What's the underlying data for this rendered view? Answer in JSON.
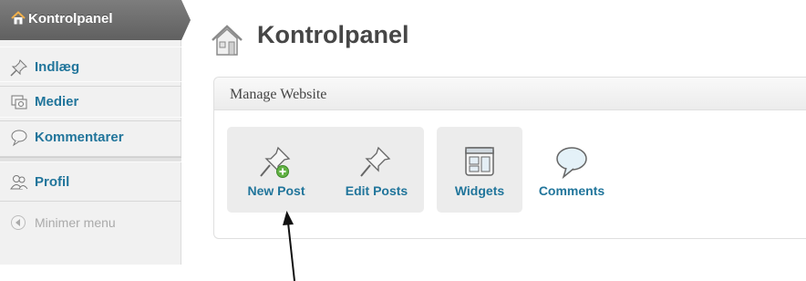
{
  "sidebar": {
    "active": {
      "label": "Kontrolpanel",
      "icon": "home-icon"
    },
    "items": [
      {
        "label": "Indlæg",
        "icon": "pushpin-icon"
      },
      {
        "label": "Medier",
        "icon": "media-icon"
      },
      {
        "label": "Kommentarer",
        "icon": "comment-icon"
      },
      {
        "label": "Profil",
        "icon": "users-icon"
      }
    ],
    "collapse": {
      "label": "Minimer menu",
      "icon": "collapse-arrow-icon"
    }
  },
  "page": {
    "title": "Kontrolpanel",
    "icon": "home-icon"
  },
  "panel": {
    "title": "Manage Website",
    "buttons": [
      {
        "label": "New Post",
        "icon": "new-post-pin-icon"
      },
      {
        "label": "Edit Posts",
        "icon": "edit-pin-icon"
      },
      {
        "label": "Widgets",
        "icon": "widgets-icon"
      },
      {
        "label": "Comments",
        "icon": "comments-bubble-icon"
      }
    ]
  },
  "colors": {
    "accent": "#21759b",
    "active_bg": "#6d6d6d",
    "sidebar_bg": "#f1f1f1"
  }
}
